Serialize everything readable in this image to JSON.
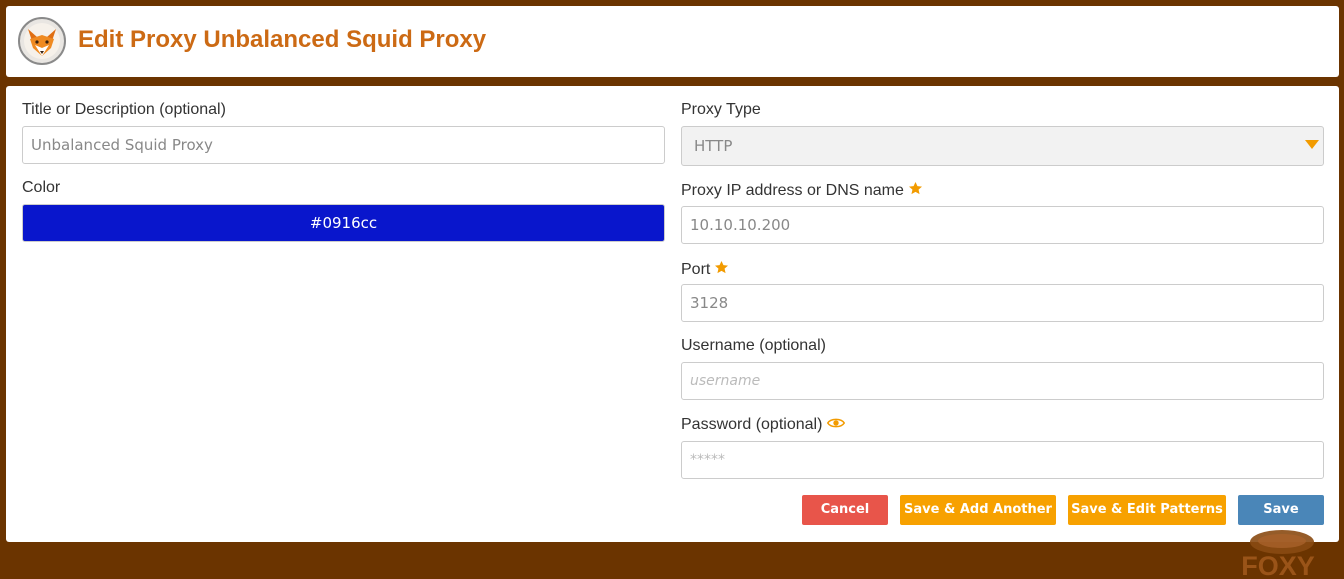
{
  "header": {
    "title": "Edit Proxy Unbalanced Squid Proxy",
    "logo_icon": "foxyproxy-logo-icon"
  },
  "form": {
    "title": {
      "label": "Title or Description (optional)",
      "value": "Unbalanced Squid Proxy"
    },
    "color": {
      "label": "Color",
      "value": "#0916cc"
    },
    "proxy_type": {
      "label": "Proxy Type",
      "value": "HTTP"
    },
    "address": {
      "label": "Proxy IP address or DNS name",
      "value": "10.10.10.200",
      "required_icon": "star-icon"
    },
    "port": {
      "label": "Port",
      "value": "3128",
      "required_icon": "star-icon"
    },
    "username": {
      "label": "Username (optional)",
      "placeholder": "username"
    },
    "password": {
      "label": "Password (optional)",
      "placeholder": "*****",
      "toggle_icon": "eye-icon"
    }
  },
  "buttons": {
    "cancel": "Cancel",
    "save_add_another": "Save & Add Another",
    "save_edit_patterns": "Save & Edit Patterns",
    "save": "Save"
  },
  "watermark": {
    "text": "FOXY"
  },
  "colors": {
    "background": "#6b3400",
    "title": "#cc6a14",
    "accent": "#f29b00",
    "cancel": "#e8554a",
    "save": "#4a86b8",
    "swatch": "#0916cc"
  }
}
